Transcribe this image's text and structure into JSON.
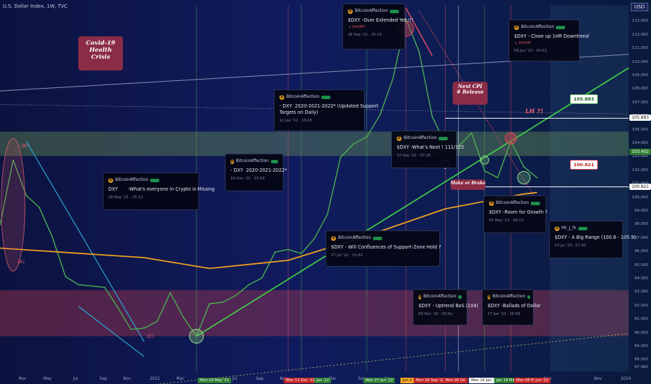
{
  "header": {
    "title": "U.S. Dollar Index, 1W, TVC",
    "currency": "USD"
  },
  "chart_data": {
    "type": "line",
    "symbol": "U.S. Dollar Index",
    "interval": "1W",
    "exchange": "TVC",
    "currency": "USD",
    "ylim": [
      87.2,
      114.2
    ],
    "y_scale": "linear",
    "y_ticks": [
      "113.000",
      "112.000",
      "111.000",
      "110.000",
      "109.000",
      "108.000",
      "107.000",
      "106.000",
      "105.000",
      "104.000",
      "103.000",
      "102.000",
      "101.000",
      "100.000",
      "99.000",
      "98.000",
      "97.000",
      "96.000",
      "95.000",
      "94.000",
      "93.000",
      "92.000",
      "91.000",
      "90.000",
      "89.000",
      "88.000",
      "87.480"
    ],
    "x_ticks": [
      "Mar",
      "May",
      "Jul",
      "Sep",
      "Nov",
      "2021",
      "Mar",
      "Jul",
      "Sep",
      "Nov",
      "Mar",
      "Sep",
      "Nov",
      "Sep",
      "Nov",
      "2024"
    ],
    "x_badges": [
      {
        "label": "Mon 24 May '21",
        "color": "#2e7d32"
      },
      {
        "label": "Mon 13 Dec '21",
        "color": "#c62828"
      },
      {
        "label": "Jan '22",
        "color": "#2e7d32"
      },
      {
        "label": "Mon 27 Jun '22",
        "color": "#2e7d32"
      },
      {
        "label": "Jun 2",
        "color": "#f9a825"
      },
      {
        "label": "Mon 26 Sep '22",
        "color": "#c62828"
      },
      {
        "label": "Mon 05 De",
        "color": "#c62828"
      },
      {
        "label": "Mon 16 Jan '23",
        "color": "#ffffff"
      },
      {
        "label": "Jan 19 Mar '2",
        "color": "#2e7d32"
      },
      {
        "label": "Mon 08 May '23",
        "color": "#c62828"
      },
      {
        "label": "Jun '23",
        "color": "#c62828"
      }
    ],
    "series": [
      {
        "color": "#4caf50",
        "x": [
          "2020-02",
          "2020-03",
          "2020-04",
          "2020-05",
          "2020-06",
          "2020-07",
          "2020-08",
          "2020-09",
          "2020-10",
          "2020-11",
          "2020-12",
          "2021-01",
          "2021-02",
          "2021-03",
          "2021-04",
          "2021-05",
          "2021-06",
          "2021-07",
          "2021-08",
          "2021-09",
          "2021-10",
          "2021-11",
          "2021-12",
          "2022-01",
          "2022-02",
          "2022-03",
          "2022-04",
          "2022-05",
          "2022-06",
          "2022-07",
          "2022-08",
          "2022-09",
          "2022-10",
          "2022-11",
          "2022-12",
          "2023-01",
          "2023-02",
          "2023-03",
          "2023-04",
          "2023-05",
          "2023-06",
          "2023-07"
        ],
        "y": [
          98.0,
          102.8,
          100.2,
          99.3,
          97.1,
          94.2,
          93.6,
          93.5,
          93.4,
          91.9,
          90.3,
          90.4,
          90.9,
          93.0,
          91.2,
          89.8,
          92.2,
          92.3,
          92.8,
          93.6,
          94.1,
          96.0,
          96.2,
          95.9,
          97.0,
          98.8,
          103.0,
          104.0,
          104.5,
          106.1,
          108.8,
          113.2,
          110.8,
          106.0,
          104.0,
          103.8,
          104.8,
          102.0,
          101.5,
          104.2,
          102.3,
          101.5
        ]
      },
      {
        "color": "#f0a020",
        "x": [
          "2020-02",
          "2021-01",
          "2021-06",
          "2021-12",
          "2022-06",
          "2022-12",
          "2023-06",
          "2023-07"
        ],
        "y": [
          96.3,
          95.6,
          94.8,
          95.4,
          97.2,
          99.2,
          100.3,
          100.4
        ]
      }
    ],
    "price_tags": [
      {
        "value": "105.883",
        "label": "105.883",
        "color": "#ffffff"
      },
      {
        "value": "103.402",
        "label": "103.402",
        "color": "#2e7d32"
      },
      {
        "value": "100.821",
        "label": "100.821",
        "color": "#ffffff"
      }
    ],
    "point_labels": [
      "(A)",
      "(B)",
      "(C)",
      "LH ?!"
    ]
  },
  "callouts": [
    {
      "text": "Covid-19\nHealth\nCrisis"
    },
    {
      "text": "Next CPI\n# Release"
    },
    {
      "text": "Make or Brake"
    }
  ],
  "annotations": [
    {
      "author": "BitcoinAffection",
      "text": "$DXY -Over Extended Yet !!!",
      "date": "26 Sep '22 · 15:19",
      "tag": "SHORT"
    },
    {
      "author": "BitcoinAffection",
      "text": "$DXY - Close up 1HR Downtrend",
      "date": "08 Jun '23 · 00:01",
      "tag": "SHORT"
    },
    {
      "author": "BitcoinAffection",
      "text": "- DXY  2020-2021-2022* (Updated Support\nTargets on Daily)",
      "date": "12 Jan '22 · 19:20",
      "tag": ""
    },
    {
      "author": "BitcoinAffection",
      "text": "- DXY  2020-2021-2022*",
      "date": "16 Dec '21 · 15:58",
      "tag": ""
    },
    {
      "author": "BitcoinAffection",
      "text": "DXY       -What's everyone in Crypto is Missing",
      "date": "28 May '21 · 15:13",
      "tag": ""
    },
    {
      "author": "BitcoinAffection",
      "text": "$DXY -What's Next ! 111/125",
      "date": "10 Sep '22 · 07:16",
      "tag": ""
    },
    {
      "author": "BitcoinAffection",
      "text": "$DXY -Room for Growth ?",
      "date": "05 May '23 · 08:12",
      "tag": ""
    },
    {
      "author": "BitcoinAffection",
      "text": "$DXY - Will Confluences of Support-Zone Hold ?",
      "date": "27 Jul '22 · 15:42",
      "tag": ""
    },
    {
      "author": "Mr_J_fx",
      "text": "$DXY - A Big Range (100.8 - 105.9)",
      "date": "10 Jul '23 · 07:43",
      "tag": ""
    },
    {
      "author": "BitcoinAffection",
      "text": "$DXY - Uptrend BoS (104)",
      "date": "09 Dec '22 · 02:6x",
      "tag": ""
    },
    {
      "author": "BitcoinAffection",
      "text": "$DXY -Ballads of Dollar",
      "date": "17 Jan '23 · 16:59",
      "tag": ""
    }
  ]
}
